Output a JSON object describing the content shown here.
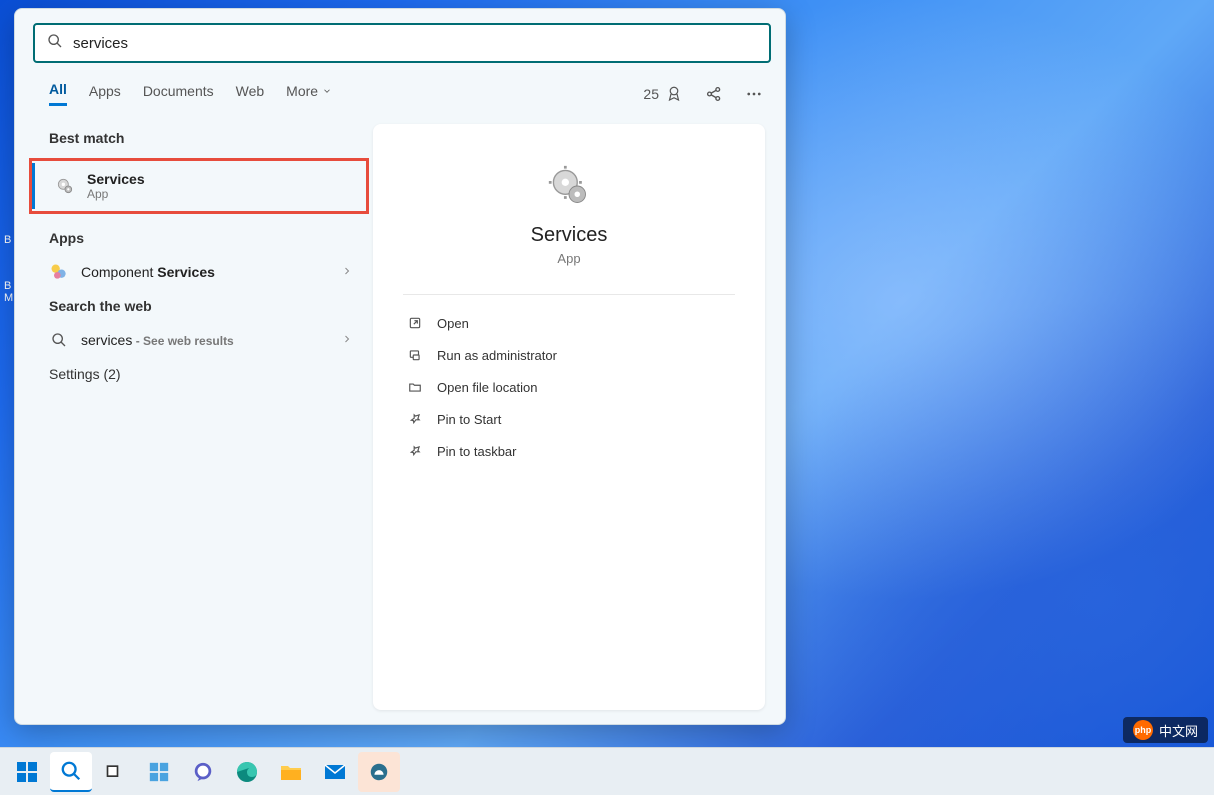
{
  "desktop_icons": {
    "icon1": "B",
    "icon2": "B\nM"
  },
  "search": {
    "value": "services"
  },
  "tabs": {
    "all": "All",
    "apps": "Apps",
    "documents": "Documents",
    "web": "Web",
    "more": "More"
  },
  "rewards": {
    "points": "25"
  },
  "sections": {
    "best_match": "Best match",
    "apps": "Apps",
    "search_web": "Search the web",
    "settings": "Settings (2)"
  },
  "best_match_item": {
    "title": "Services",
    "sub": "App"
  },
  "apps_item": {
    "prefix": "Component ",
    "bold": "Services"
  },
  "web_item": {
    "prefix": "services",
    "suffix": " - See web results"
  },
  "preview": {
    "title": "Services",
    "sub": "App"
  },
  "actions": {
    "open": "Open",
    "run_admin": "Run as administrator",
    "open_location": "Open file location",
    "pin_start": "Pin to Start",
    "pin_taskbar": "Pin to taskbar"
  },
  "watermark": {
    "logo": "php",
    "text": "中文网"
  }
}
